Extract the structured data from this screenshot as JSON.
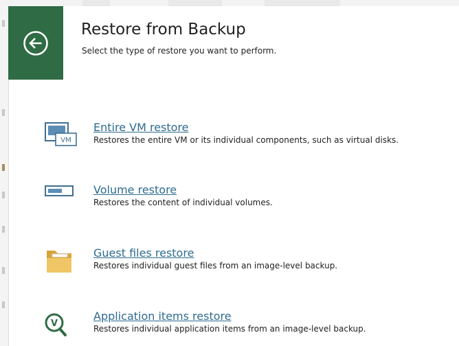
{
  "header": {
    "title": "Restore from Backup",
    "subtitle": "Select the type of restore you want to perform.",
    "back_icon": "back-arrow-icon"
  },
  "colors": {
    "back_tile": "#2f6b45",
    "link": "#2d6b8f",
    "folder": "#e8b84a"
  },
  "options": [
    {
      "title": "Entire VM restore",
      "description": "Restores the entire VM or its individual components, such as virtual disks.",
      "icon": "vm-icon",
      "icon_text": "VM"
    },
    {
      "title": "Volume restore",
      "description": "Restores the content of individual volumes.",
      "icon": "volume-icon"
    },
    {
      "title": "Guest files restore",
      "description": "Restores individual guest files from an image-level backup.",
      "icon": "folder-icon"
    },
    {
      "title": "Application items restore",
      "description": "Restores individual application items from an image-level backup.",
      "icon": "application-search-icon",
      "icon_text": "V"
    }
  ]
}
